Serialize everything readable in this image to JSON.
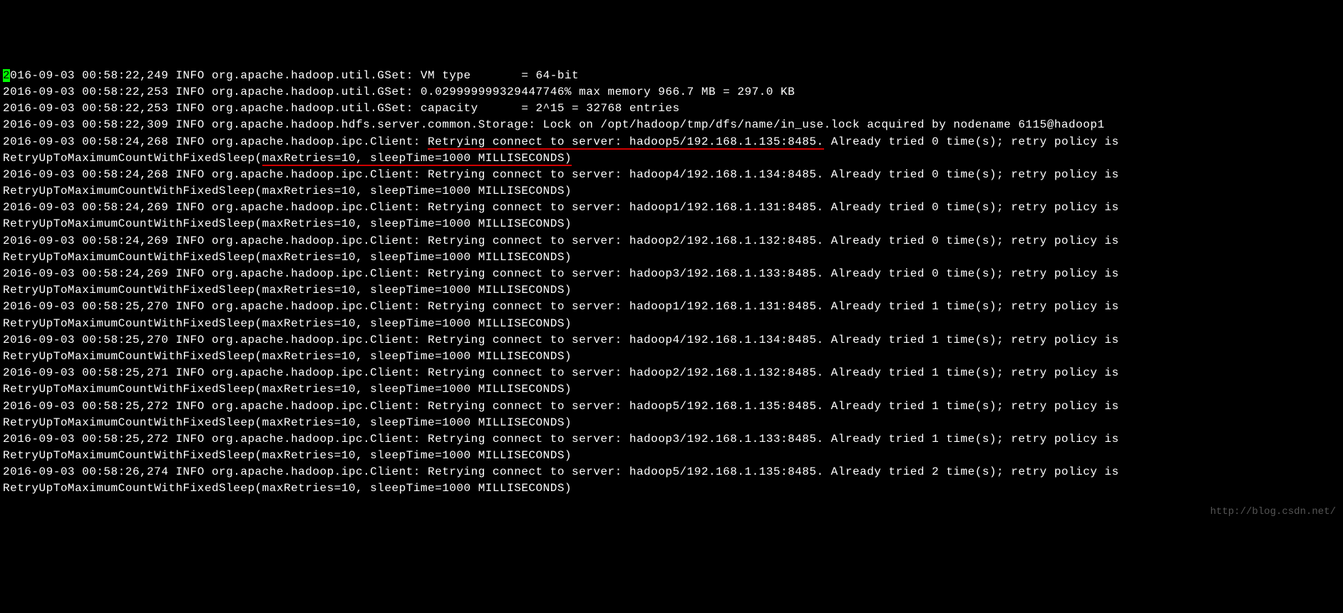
{
  "cursor_char": "2",
  "lines": [
    {
      "prefix_cursor": true,
      "text": "016-09-03 00:58:22,249 INFO org.apache.hadoop.util.GSet: VM type       = 64-bit"
    },
    {
      "text": "2016-09-03 00:58:22,253 INFO org.apache.hadoop.util.GSet: 0.029999999329447746% max memory 966.7 MB = 297.0 KB"
    },
    {
      "text": "2016-09-03 00:58:22,253 INFO org.apache.hadoop.util.GSet: capacity      = 2^15 = 32768 entries"
    },
    {
      "text": "2016-09-03 00:58:22,309 INFO org.apache.hadoop.hdfs.server.common.Storage: Lock on /opt/hadoop/tmp/dfs/name/in_use.lock acquired by nodename 6115@hadoop1"
    },
    {
      "text_before": "2016-09-03 00:58:24,268 INFO org.apache.hadoop.ipc.Client: ",
      "underline1": "Retrying connect to server: hadoop5/192.168.1.135:8485.",
      "text_mid": " Already tried 0 time(s); retry policy is RetryUpToMaximumCountWithFixedSleep(",
      "underline2": "maxRetries=10, sleepTime=1000 MILLISECONDS)",
      "has_underline": true
    },
    {
      "text": "2016-09-03 00:58:24,268 INFO org.apache.hadoop.ipc.Client: Retrying connect to server: hadoop4/192.168.1.134:8485. Already tried 0 time(s); retry policy is RetryUpToMaximumCountWithFixedSleep(maxRetries=10, sleepTime=1000 MILLISECONDS)"
    },
    {
      "text": "2016-09-03 00:58:24,269 INFO org.apache.hadoop.ipc.Client: Retrying connect to server: hadoop1/192.168.1.131:8485. Already tried 0 time(s); retry policy is RetryUpToMaximumCountWithFixedSleep(maxRetries=10, sleepTime=1000 MILLISECONDS)"
    },
    {
      "text": "2016-09-03 00:58:24,269 INFO org.apache.hadoop.ipc.Client: Retrying connect to server: hadoop2/192.168.1.132:8485. Already tried 0 time(s); retry policy is RetryUpToMaximumCountWithFixedSleep(maxRetries=10, sleepTime=1000 MILLISECONDS)"
    },
    {
      "text": "2016-09-03 00:58:24,269 INFO org.apache.hadoop.ipc.Client: Retrying connect to server: hadoop3/192.168.1.133:8485. Already tried 0 time(s); retry policy is RetryUpToMaximumCountWithFixedSleep(maxRetries=10, sleepTime=1000 MILLISECONDS)"
    },
    {
      "text": "2016-09-03 00:58:25,270 INFO org.apache.hadoop.ipc.Client: Retrying connect to server: hadoop1/192.168.1.131:8485. Already tried 1 time(s); retry policy is RetryUpToMaximumCountWithFixedSleep(maxRetries=10, sleepTime=1000 MILLISECONDS)"
    },
    {
      "text": "2016-09-03 00:58:25,270 INFO org.apache.hadoop.ipc.Client: Retrying connect to server: hadoop4/192.168.1.134:8485. Already tried 1 time(s); retry policy is RetryUpToMaximumCountWithFixedSleep(maxRetries=10, sleepTime=1000 MILLISECONDS)"
    },
    {
      "text": "2016-09-03 00:58:25,271 INFO org.apache.hadoop.ipc.Client: Retrying connect to server: hadoop2/192.168.1.132:8485. Already tried 1 time(s); retry policy is RetryUpToMaximumCountWithFixedSleep(maxRetries=10, sleepTime=1000 MILLISECONDS)"
    },
    {
      "text": "2016-09-03 00:58:25,272 INFO org.apache.hadoop.ipc.Client: Retrying connect to server: hadoop5/192.168.1.135:8485. Already tried 1 time(s); retry policy is RetryUpToMaximumCountWithFixedSleep(maxRetries=10, sleepTime=1000 MILLISECONDS)"
    },
    {
      "text": "2016-09-03 00:58:25,272 INFO org.apache.hadoop.ipc.Client: Retrying connect to server: hadoop3/192.168.1.133:8485. Already tried 1 time(s); retry policy is RetryUpToMaximumCountWithFixedSleep(maxRetries=10, sleepTime=1000 MILLISECONDS)"
    },
    {
      "text": "2016-09-03 00:58:26,274 INFO org.apache.hadoop.ipc.Client: Retrying connect to server: hadoop5/192.168.1.135:8485. Already tried 2 time(s); retry policy is RetryUpToMaximumCountWithFixedSleep(maxRetries=10, sleepTime=1000 MILLISECONDS)"
    }
  ],
  "watermark": "http://blog.csdn.net/"
}
